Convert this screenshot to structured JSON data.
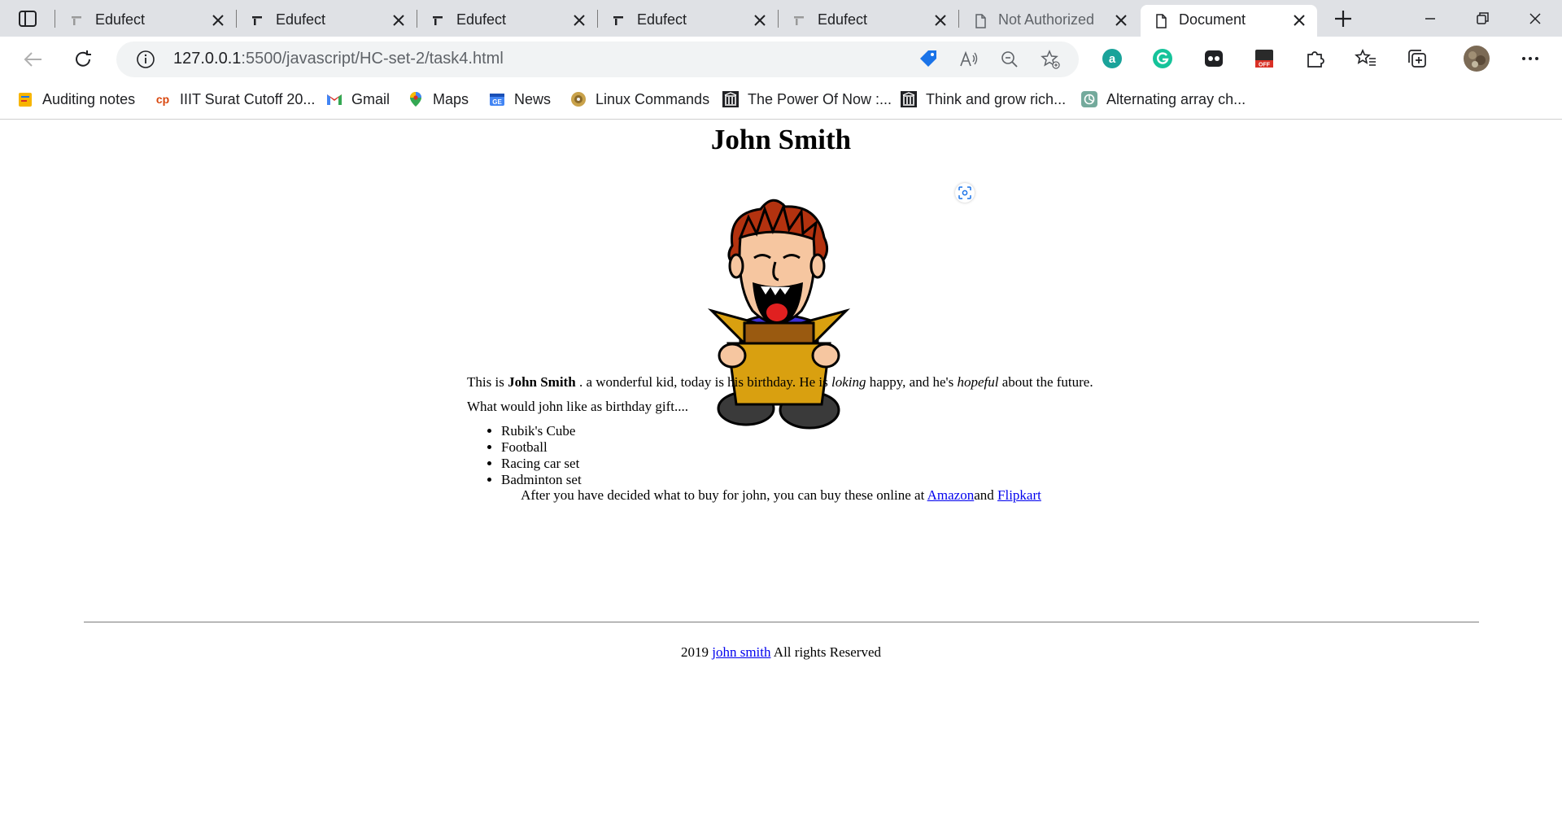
{
  "browser": {
    "tabs": [
      {
        "title": "Edufect",
        "icon": "edufect-icon"
      },
      {
        "title": "Edufect",
        "icon": "edufect-icon"
      },
      {
        "title": "Edufect",
        "icon": "edufect-icon"
      },
      {
        "title": "Edufect",
        "icon": "edufect-icon"
      },
      {
        "title": "Edufect",
        "icon": "edufect-icon"
      },
      {
        "title": "Not Authorized",
        "icon": "page-icon"
      },
      {
        "title": "Document",
        "icon": "page-icon",
        "active": true
      }
    ],
    "url_host": "127.0.0.1",
    "url_rest": ":5500/javascript/HC-set-2/task4.html",
    "bookmarks": [
      {
        "label": "Auditing notes",
        "icon": "notes-icon"
      },
      {
        "label": "IIIT Surat Cutoff 20...",
        "icon": "cp-icon"
      },
      {
        "label": "Gmail",
        "icon": "gmail-icon"
      },
      {
        "label": "Maps",
        "icon": "maps-icon"
      },
      {
        "label": "News",
        "icon": "news-icon"
      },
      {
        "label": "Linux Commands",
        "icon": "disc-icon"
      },
      {
        "label": "The Power Of Now :...",
        "icon": "library-icon"
      },
      {
        "label": "Think and grow rich...",
        "icon": "library-icon"
      },
      {
        "label": "Alternating array ch...",
        "icon": "openai-icon"
      }
    ],
    "colors": {
      "accent_blue": "#1a73e8",
      "tab_strip": "#dfe1e5"
    }
  },
  "page": {
    "heading": "John Smith",
    "intro": {
      "p1": "This is ",
      "name": "John Smith",
      "p2": " . a wonderful kid, today is his birthday. He is ",
      "em1": "loking",
      "p3": " happy, and he's ",
      "em2": "hopeful",
      "p4": " about the future."
    },
    "question": "What would john like as birthday gift....",
    "gifts": [
      "Rubik's Cube",
      "Football",
      "Racing car set",
      "Badminton set"
    ],
    "buy": {
      "text": "After you have decided what to buy for john, you can buy these online at ",
      "amazon": "Amazon",
      "and": "and ",
      "flipkart": "Flipkart"
    },
    "footer": {
      "year": "2019 ",
      "link": "john smith",
      "rest": " All rights Reserved"
    }
  }
}
